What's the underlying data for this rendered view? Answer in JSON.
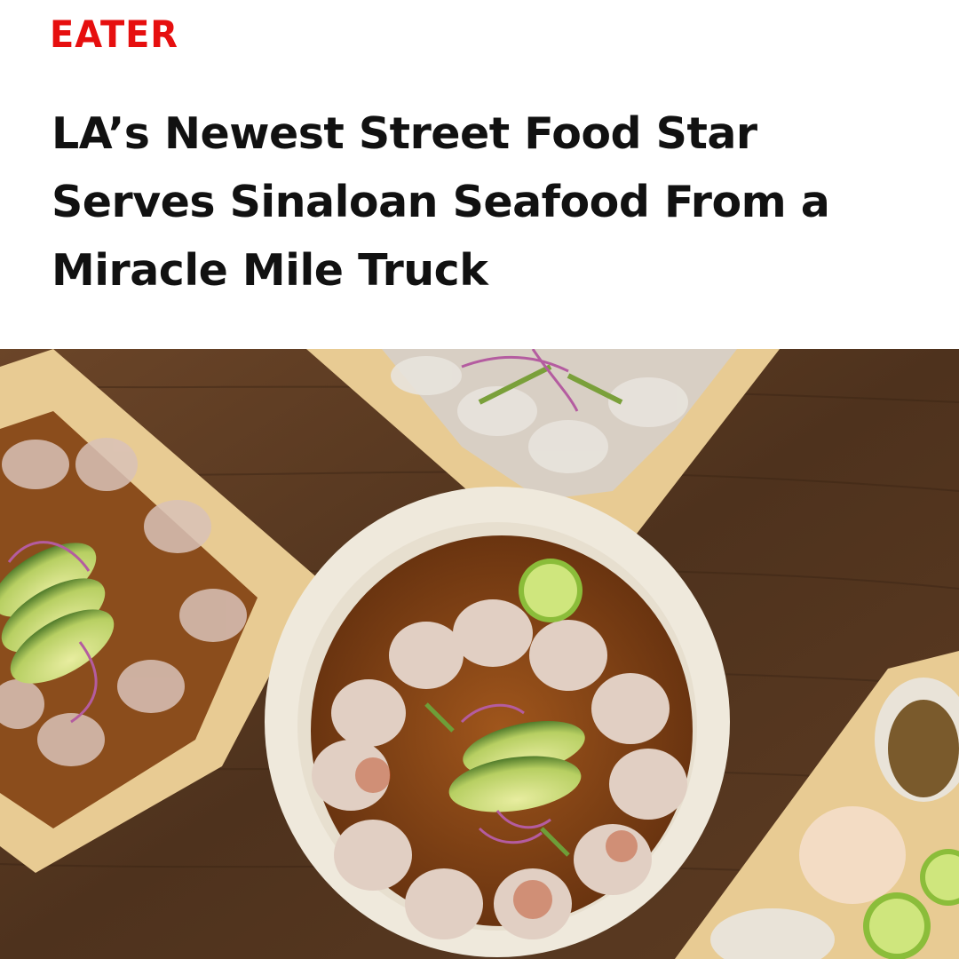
{
  "brand": {
    "name": "EATER",
    "color": "#e60f0f"
  },
  "article": {
    "headline": "LA’s Newest Street Food Star Serves Sinaloan Seafood From a Miracle Mile Truck"
  },
  "hero_image": {
    "subject": "food-photo",
    "colors": {
      "table": "#5b3a22",
      "leaf_tray": "#e8cb93",
      "plate": "#efe9dc",
      "sauce": "#7a3e12"
    }
  }
}
